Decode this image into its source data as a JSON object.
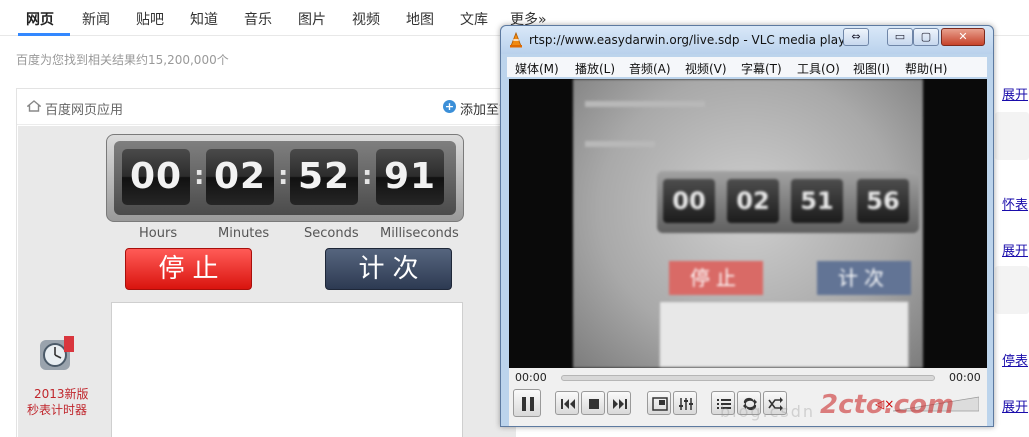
{
  "nav": {
    "items": [
      "网页",
      "新闻",
      "贴吧",
      "知道",
      "音乐",
      "图片",
      "视频",
      "地图",
      "文库",
      "更多»"
    ]
  },
  "result_count": "百度为您找到相关结果约15,200,000个",
  "app": {
    "title": "百度网页应用",
    "add_text": "添加至首页",
    "add_plus": "+",
    "timer": {
      "digits": [
        "00",
        "02",
        "52",
        "91"
      ],
      "separator": ":",
      "labels": [
        "Hours",
        "Minutes",
        "Seconds",
        "Milliseconds"
      ]
    },
    "stop_label": "停止",
    "lap_label": "计次",
    "side_app_line1": "2013新版",
    "side_app_line2": "秒表计时器"
  },
  "right_links": [
    "展开",
    "怀表",
    "展开",
    "停表",
    "展开"
  ],
  "vlc": {
    "title": "rtsp://www.easydarwin.org/live.sdp - VLC media player",
    "window_buttons": [
      "⇔",
      "▭",
      "▢",
      "✕"
    ],
    "menu": [
      "媒体(M)",
      "播放(L)",
      "音频(A)",
      "视频(V)",
      "字幕(T)",
      "工具(O)",
      "视图(I)",
      "帮助(H)"
    ],
    "video_digits": [
      "00",
      "02",
      "51",
      "56"
    ],
    "video_stop": "停止",
    "video_lap": "计次",
    "time_elapsed": "00:00",
    "time_total": "00:00",
    "volume_icon": "◁×"
  },
  "watermark": {
    "brand": "2cto.com",
    "blog": "blog.csdn"
  },
  "colors": {
    "accent": "#3388ff",
    "stop_red": "#e0201a",
    "lap_blue": "#3a4862",
    "vlc_frame": "#bcd4ec"
  }
}
